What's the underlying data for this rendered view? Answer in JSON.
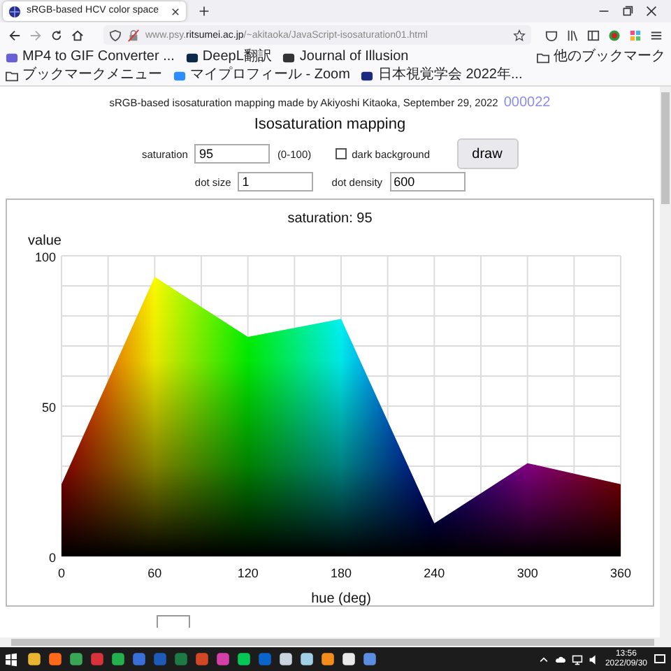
{
  "browser": {
    "tab": {
      "title": "sRGB-based HCV color space",
      "selected": true
    },
    "address": "www.psy.**ritsumei.ac.jp**/~akitaoka/JavaScript-isosaturation01.html",
    "bookmarks": [
      {
        "label": "MP4 to GIF Converter ..."
      },
      {
        "label": "DeepL翻訳"
      },
      {
        "label": "Journal of Illusion"
      },
      {
        "label": "ブックマークメニュー",
        "kind": "folder"
      },
      {
        "label": "マイプロフィール - Zoom"
      },
      {
        "label": "日本視覚学会 2022年..."
      }
    ],
    "other_bookmarks": "他のブックマーク"
  },
  "page": {
    "credit": "sRGB-based isosaturation mapping made by Akiyoshi Kitaoka, September 29, 2022",
    "counter": "000022",
    "title": "Isosaturation mapping",
    "saturation": {
      "label": "saturation",
      "value": "95",
      "range": "(0-100)"
    },
    "dark_background": {
      "label": "dark background",
      "checked": false
    },
    "draw_button": "draw",
    "dot_size": {
      "label": "dot size",
      "value": "1"
    },
    "dot_density": {
      "label": "dot density",
      "value": "600"
    },
    "chart": {
      "chart_data": {
        "type": "area",
        "title": "saturation: 95",
        "xlabel": "hue (deg)",
        "ylabel": "value",
        "x": [
          0,
          60,
          120,
          180,
          240,
          300,
          360
        ],
        "series": [
          {
            "values": [
              24,
              93,
              73,
              79,
              11,
              31,
              24
            ]
          }
        ],
        "grid": true,
        "xlim": [
          0,
          360
        ],
        "ylim": [
          0,
          100
        ],
        "xticks": [
          0,
          60,
          120,
          180,
          240,
          300,
          360
        ],
        "yticks": [
          0,
          50,
          100
        ]
      }
    }
  },
  "taskbar": {
    "time": "13:56",
    "date": "2022/09/30"
  }
}
